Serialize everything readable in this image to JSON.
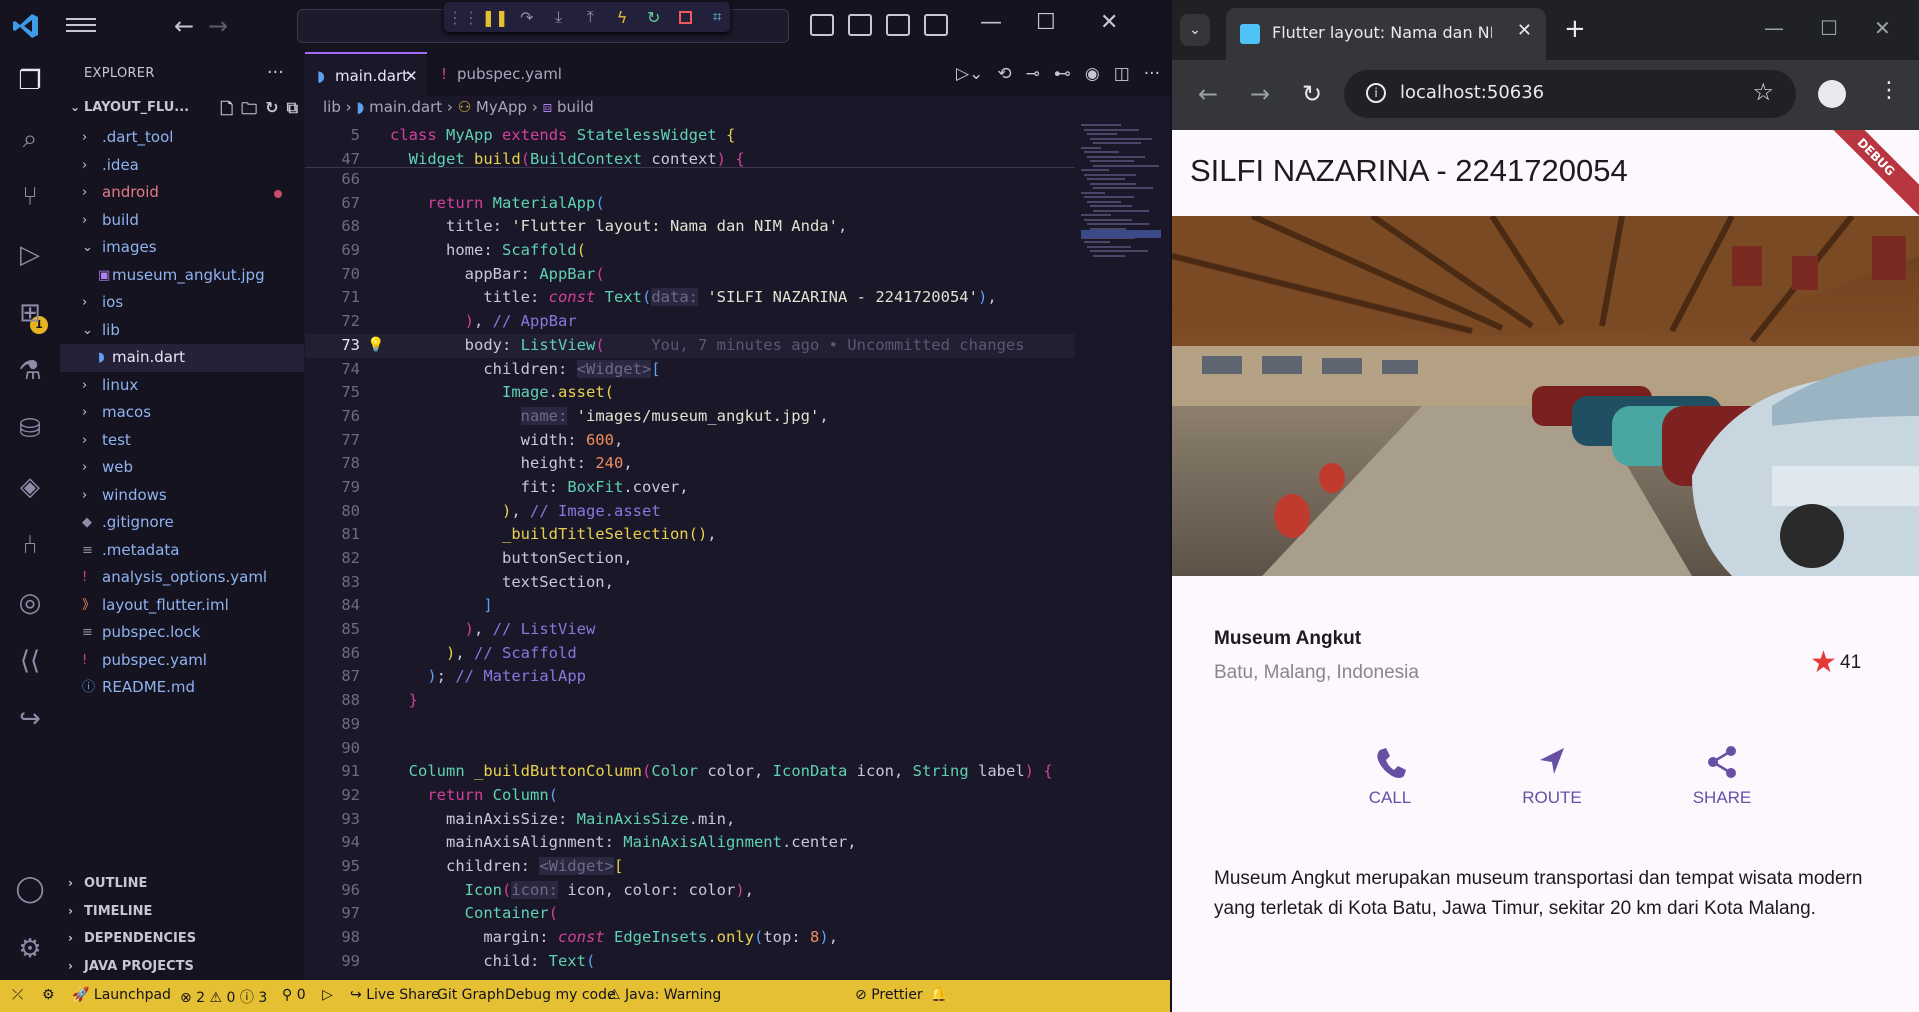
{
  "vscode": {
    "explorer_title": "EXPLORER",
    "project_name": "LAYOUT_FLU...",
    "tree": [
      {
        "label": ".dart_tool",
        "type": "folder",
        "color": "#8fb3f0"
      },
      {
        "label": ".idea",
        "type": "folder",
        "color": "#8fb3f0"
      },
      {
        "label": "android",
        "type": "folder",
        "color": "#e07a8a"
      },
      {
        "label": "build",
        "type": "folder",
        "color": "#8fb3f0"
      },
      {
        "label": "images",
        "type": "folder-open",
        "color": "#8fb3f0"
      },
      {
        "label": "museum_angkut.jpg",
        "type": "file-child",
        "color": "#8fb3f0",
        "icon": "image-icon"
      },
      {
        "label": "ios",
        "type": "folder",
        "color": "#8fb3f0"
      },
      {
        "label": "lib",
        "type": "folder-open",
        "color": "#8fb3f0"
      },
      {
        "label": "main.dart",
        "type": "file-child",
        "color": "#e8e6f4",
        "icon": "dart-icon"
      },
      {
        "label": "linux",
        "type": "folder",
        "color": "#8fb3f0"
      },
      {
        "label": "macos",
        "type": "folder",
        "color": "#8fb3f0"
      },
      {
        "label": "test",
        "type": "folder",
        "color": "#8fb3f0"
      },
      {
        "label": "web",
        "type": "folder",
        "color": "#8fb3f0"
      },
      {
        "label": "windows",
        "type": "folder",
        "color": "#8fb3f0"
      },
      {
        "label": ".gitignore",
        "type": "file",
        "color": "#8fb3f0",
        "icon": "git-icon"
      },
      {
        "label": ".metadata",
        "type": "file",
        "color": "#8fb3f0",
        "icon": "lines-icon"
      },
      {
        "label": "analysis_options.yaml",
        "type": "file",
        "color": "#8fb3f0",
        "icon": "yaml-icon"
      },
      {
        "label": "layout_flutter.iml",
        "type": "file",
        "color": "#8fb3f0",
        "icon": "rss-icon"
      },
      {
        "label": "pubspec.lock",
        "type": "file",
        "color": "#8fb3f0",
        "icon": "lines-icon"
      },
      {
        "label": "pubspec.yaml",
        "type": "file",
        "color": "#8fb3f0",
        "icon": "yaml-icon"
      },
      {
        "label": "README.md",
        "type": "file",
        "color": "#8fb3f0",
        "icon": "info-icon"
      }
    ],
    "sections": [
      "OUTLINE",
      "TIMELINE",
      "DEPENDENCIES",
      "JAVA PROJECTS"
    ],
    "tabs": [
      {
        "label": "main.dart",
        "active": true
      },
      {
        "label": "pubspec.yaml",
        "active": false
      }
    ],
    "breadcrumb": [
      "lib",
      "main.dart",
      "MyApp",
      "build"
    ],
    "sticky": [
      {
        "ln": "5",
        "html": "<span class='k'>class</span> <span class='t'>MyApp</span> <span class='k'>extends</span> <span class='t'>StatelessWidget</span> <span class='b1'>{</span>"
      },
      {
        "ln": "47",
        "html": "  <span class='t'>Widget</span> <span class='f'>build</span><span class='b2'>(</span><span class='t'>BuildContext</span> context<span class='b2'>)</span> <span class='b2'>{</span>"
      }
    ],
    "code": [
      {
        "ln": "66",
        "html": ""
      },
      {
        "ln": "67",
        "html": "    <span class='k'>return</span> <span class='t'>MaterialApp</span><span class='b3'>(</span>"
      },
      {
        "ln": "68",
        "html": "      title: <span class='s'>'Flutter layout: Nama dan NIM Anda'</span>,"
      },
      {
        "ln": "69",
        "html": "      home: <span class='t'>Scaffold</span><span class='b1'>(</span>"
      },
      {
        "ln": "70",
        "html": "        appBar: <span class='t'>AppBar</span><span class='b2'>(</span>"
      },
      {
        "ln": "71",
        "html": "          title: <span class='k ital'>const</span> <span class='t'>Text</span><span class='b3'>(</span><span class='h'>data:</span> <span class='s'>'SILFI NAZARINA - 2241720054'</span><span class='b3'>)</span>,"
      },
      {
        "ln": "72",
        "html": "        <span class='b2'>)</span>, <span class='c'>// AppBar</span>"
      },
      {
        "ln": "73",
        "html": "        body: <span class='t'>ListView</span><span class='b2'>(</span>     <span class='ghost'>You, 7 minutes ago • Uncommitted changes</span>",
        "cur": true
      },
      {
        "ln": "74",
        "html": "          children: <span class='h'>&lt;Widget&gt;</span><span class='b3'>[</span>"
      },
      {
        "ln": "75",
        "html": "            <span class='t'>Image</span>.<span class='f'>asset</span><span class='b1'>(</span>"
      },
      {
        "ln": "76",
        "html": "              <span class='h'>name:</span> <span class='s'>'images/museum_angkut.jpg'</span>,"
      },
      {
        "ln": "77",
        "html": "              width: <span class='n'>600</span>,"
      },
      {
        "ln": "78",
        "html": "              height: <span class='n'>240</span>,"
      },
      {
        "ln": "79",
        "html": "              fit: <span class='t'>BoxFit</span>.cover,"
      },
      {
        "ln": "80",
        "html": "            <span class='b1'>)</span>, <span class='c'>// Image.asset</span>"
      },
      {
        "ln": "81",
        "html": "            <span class='f'>_buildTitleSelection</span><span class='b1'>()</span>,"
      },
      {
        "ln": "82",
        "html": "            buttonSection,"
      },
      {
        "ln": "83",
        "html": "            textSection,"
      },
      {
        "ln": "84",
        "html": "          <span class='b3'>]</span>"
      },
      {
        "ln": "85",
        "html": "        <span class='b2'>)</span>, <span class='c'>// ListView</span>"
      },
      {
        "ln": "86",
        "html": "      <span class='b1'>)</span>, <span class='c'>// Scaffold</span>"
      },
      {
        "ln": "87",
        "html": "    <span class='b3'>)</span>; <span class='c'>// MaterialApp</span>"
      },
      {
        "ln": "88",
        "html": "  <span class='b2'>}</span>"
      },
      {
        "ln": "89",
        "html": ""
      },
      {
        "ln": "90",
        "html": ""
      },
      {
        "ln": "91",
        "html": "  <span class='t'>Column</span> <span class='f'>_buildButtonColumn</span><span class='b2'>(</span><span class='t'>Color</span> color, <span class='t'>IconData</span> icon, <span class='t'>String</span> label<span class='b2'>)</span> <span class='b2'>{</span>"
      },
      {
        "ln": "92",
        "html": "    <span class='k'>return</span> <span class='t'>Column</span><span class='b3'>(</span>"
      },
      {
        "ln": "93",
        "html": "      mainAxisSize: <span class='t'>MainAxisSize</span>.min,"
      },
      {
        "ln": "94",
        "html": "      mainAxisAlignment: <span class='t'>MainAxisAlignment</span>.center,"
      },
      {
        "ln": "95",
        "html": "      children: <span class='h'>&lt;Widget&gt;</span><span class='b1'>[</span>"
      },
      {
        "ln": "96",
        "html": "        <span class='t'>Icon</span><span class='b2'>(</span><span class='h'>icon:</span> icon, color: color<span class='b2'>)</span>,"
      },
      {
        "ln": "97",
        "html": "        <span class='t'>Container</span><span class='b2'>(</span>"
      },
      {
        "ln": "98",
        "html": "          margin: <span class='k ital'>const</span> <span class='t'>EdgeInsets</span>.<span class='f'>only</span><span class='b3'>(</span>top: <span class='n'>8</span><span class='b3'>)</span>,"
      },
      {
        "ln": "99",
        "html": "          child: <span class='t'>Text</span><span class='b3'>(</span>"
      }
    ],
    "status": {
      "launchpad": "Launchpad",
      "problems": "⊗ 2 ⚠ 0 ⓘ 3",
      "ports": "0",
      "live_share": "Live Share",
      "git_graph": "Git Graph",
      "debug": "Debug my code",
      "java": "Java: Warning",
      "prettier": "Prettier"
    },
    "activity_badge": "1"
  },
  "chrome": {
    "tab_title": "Flutter layout: Nama dan NIM Anda",
    "url": "localhost:50636"
  },
  "app": {
    "title": "SILFI NAZARINA - 2241720054",
    "debug_banner": "DEBUG",
    "place_name": "Museum Angkut",
    "location": "Batu, Malang, Indonesia",
    "rating": "41",
    "buttons": [
      {
        "label": "CALL",
        "icon": "phone-icon"
      },
      {
        "label": "ROUTE",
        "icon": "navigation-icon"
      },
      {
        "label": "SHARE",
        "icon": "share-icon"
      }
    ],
    "description": "Museum Angkut merupakan museum transportasi dan tempat wisata modern yang terletak di Kota Batu, Jawa Timur, sekitar 20 km dari Kota Malang.",
    "accent_color": "#6750a4",
    "star_color": "#e53935"
  }
}
